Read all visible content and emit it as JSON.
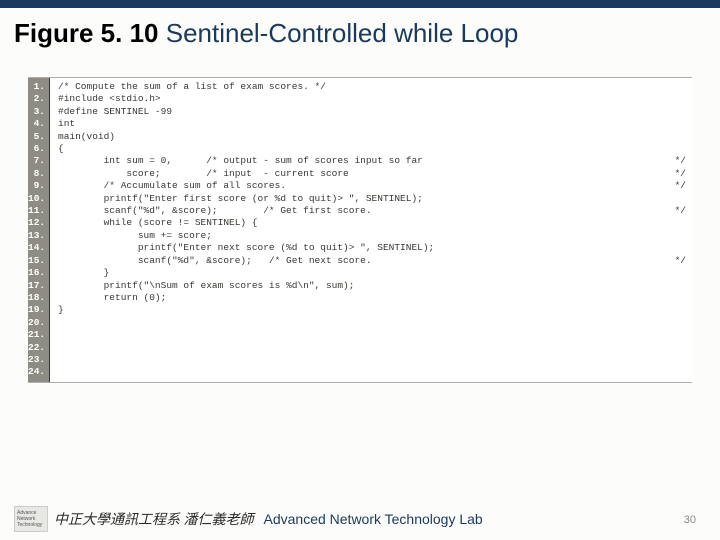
{
  "title": {
    "figure_label": "Figure 5. 10",
    "description": "  Sentinel-Controlled while Loop"
  },
  "code": {
    "line_count": 24,
    "lines": [
      {
        "n": 1,
        "t": "/* Compute the sum of a list of exam scores. */",
        "r": ""
      },
      {
        "n": 2,
        "t": "",
        "r": ""
      },
      {
        "n": 3,
        "t": "#include <stdio.h>",
        "r": ""
      },
      {
        "n": 4,
        "t": "",
        "r": ""
      },
      {
        "n": 5,
        "t": "#define SENTINEL -99",
        "r": ""
      },
      {
        "n": 6,
        "t": "",
        "r": ""
      },
      {
        "n": 7,
        "t": "int",
        "r": ""
      },
      {
        "n": 8,
        "t": "main(void)",
        "r": ""
      },
      {
        "n": 9,
        "t": "{",
        "r": ""
      },
      {
        "n": 10,
        "t": "        int sum = 0,      /* output - sum of scores input so far",
        "r": "*/"
      },
      {
        "n": 11,
        "t": "            score;        /* input  - current score",
        "r": "*/"
      },
      {
        "n": 12,
        "t": "",
        "r": ""
      },
      {
        "n": 13,
        "t": "        /* Accumulate sum of all scores.",
        "r": "*/"
      },
      {
        "n": 14,
        "t": "        printf(\"Enter first score (or %d to quit)> \", SENTINEL);",
        "r": ""
      },
      {
        "n": 15,
        "t": "        scanf(\"%d\", &score);        /* Get first score.",
        "r": "*/"
      },
      {
        "n": 16,
        "t": "        while (score != SENTINEL) {",
        "r": ""
      },
      {
        "n": 17,
        "t": "              sum += score;",
        "r": ""
      },
      {
        "n": 18,
        "t": "              printf(\"Enter next score (%d to quit)> \", SENTINEL);",
        "r": ""
      },
      {
        "n": 19,
        "t": "              scanf(\"%d\", &score);   /* Get next score.",
        "r": "*/"
      },
      {
        "n": 20,
        "t": "        }",
        "r": ""
      },
      {
        "n": 21,
        "t": "        printf(\"\\nSum of exam scores is %d\\n\", sum);",
        "r": ""
      },
      {
        "n": 22,
        "t": "",
        "r": ""
      },
      {
        "n": 23,
        "t": "        return (0);",
        "r": ""
      },
      {
        "n": 24,
        "t": "}",
        "r": ""
      }
    ]
  },
  "footer": {
    "logo_lines": [
      "Advance",
      "Network",
      "Technology"
    ],
    "chinese": "中正大學通訊工程系 潘仁義老師",
    "lab": "Advanced Network Technology Lab",
    "page_number": "30"
  }
}
